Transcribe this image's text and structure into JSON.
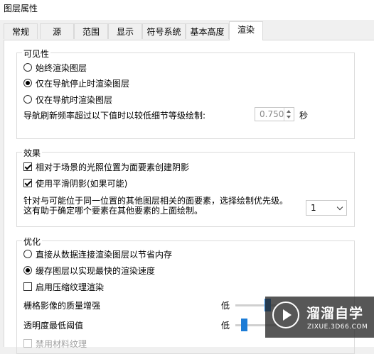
{
  "window": {
    "title": "图层属性"
  },
  "tabs": [
    {
      "label": "常规"
    },
    {
      "label": "源"
    },
    {
      "label": "范围"
    },
    {
      "label": "显示"
    },
    {
      "label": "符号系统"
    },
    {
      "label": "基本高度"
    },
    {
      "label": "渲染"
    }
  ],
  "visibility": {
    "legend": "可见性",
    "options": [
      {
        "label": "始终渲染图层",
        "selected": false
      },
      {
        "label": "仅在导航停止时渲染图层",
        "selected": true
      },
      {
        "label": "仅在导航时渲染图层",
        "selected": false
      }
    ],
    "refresh_label": "导航刷新频率超过以下值时以较低细节等级绘制:",
    "refresh_value": "0.750",
    "refresh_unit": "秒"
  },
  "effects": {
    "legend": "效果",
    "checks": [
      {
        "label": "相对于场景的光照位置为面要素创建阴影",
        "checked": true
      },
      {
        "label": "使用平滑阴影(如果可能)",
        "checked": true
      }
    ],
    "priority_line1": "针对与可能位于同一位置的其他图层相关的面要素，选择绘制优先级。",
    "priority_line2": "这有助于确定哪个要素在其他要素的上面绘制。",
    "priority_value": "1"
  },
  "optimize": {
    "legend": "优化",
    "options": [
      {
        "label": "直接从数据连接渲染图层以节省内存",
        "selected": false
      },
      {
        "label": "缓存图层以实现最快的渲染速度",
        "selected": true
      }
    ],
    "compress_label": "启用压缩纹理渲染",
    "raster_label": "栅格影像的质量增强",
    "raster_low": "低",
    "raster_level": 0.55,
    "alpha_label": "透明度最低阈值",
    "alpha_low": "低",
    "alpha_level": 0.1,
    "material_label": "禁用材料纹理"
  },
  "watermark": {
    "title": "溜溜自学",
    "subtitle": "ZIXUE.3D66.COM"
  }
}
